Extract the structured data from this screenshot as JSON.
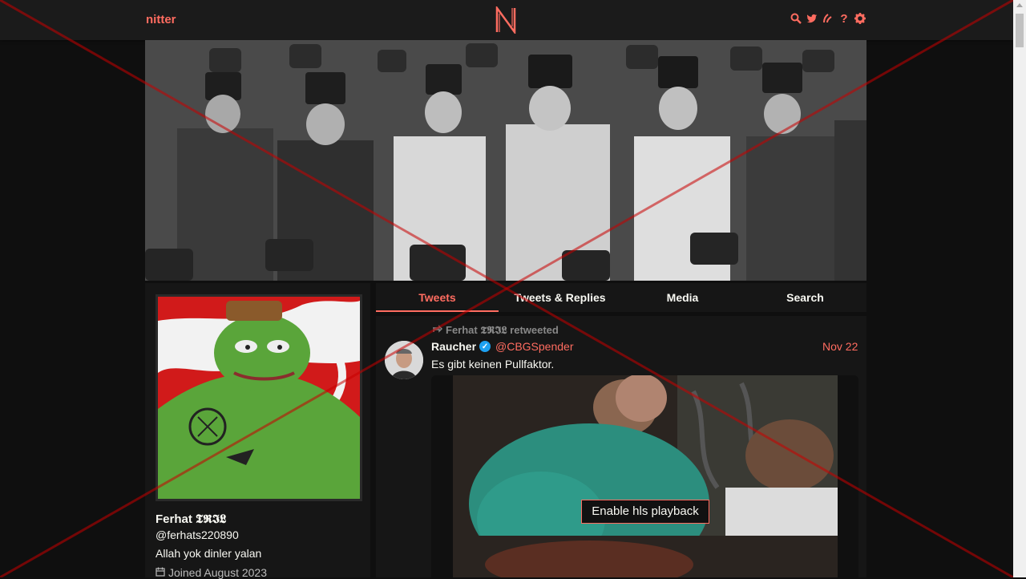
{
  "navbar": {
    "brand": "nitter",
    "logo_letter": "N",
    "icons": [
      "search-icon",
      "bird-icon",
      "rss-icon",
      "help-icon",
      "gear-icon"
    ]
  },
  "profile": {
    "fullname": "Ferhat 𝕿𝕽𝕴𝕷",
    "username": "@ferhats220890",
    "bio": "Allah yok dinler yalan",
    "joined": "Joined August 2023"
  },
  "tabs": [
    {
      "label": "Tweets",
      "active": true
    },
    {
      "label": "Tweets & Replies",
      "active": false
    },
    {
      "label": "Media",
      "active": false
    },
    {
      "label": "Search",
      "active": false
    }
  ],
  "tweet": {
    "retweet_header": "Ferhat 𝕿𝕽𝕴𝕷 retweeted",
    "fullname": "Raucher",
    "username": "@CBGSpender",
    "date": "Nov 22",
    "text": "Es gibt keinen Pullfaktor.",
    "video_button": "Enable hls playback"
  },
  "colors": {
    "accent": "#ff6c60",
    "background": "#0f0f0f",
    "panel": "#161616",
    "navbar": "#1b1b1b"
  }
}
